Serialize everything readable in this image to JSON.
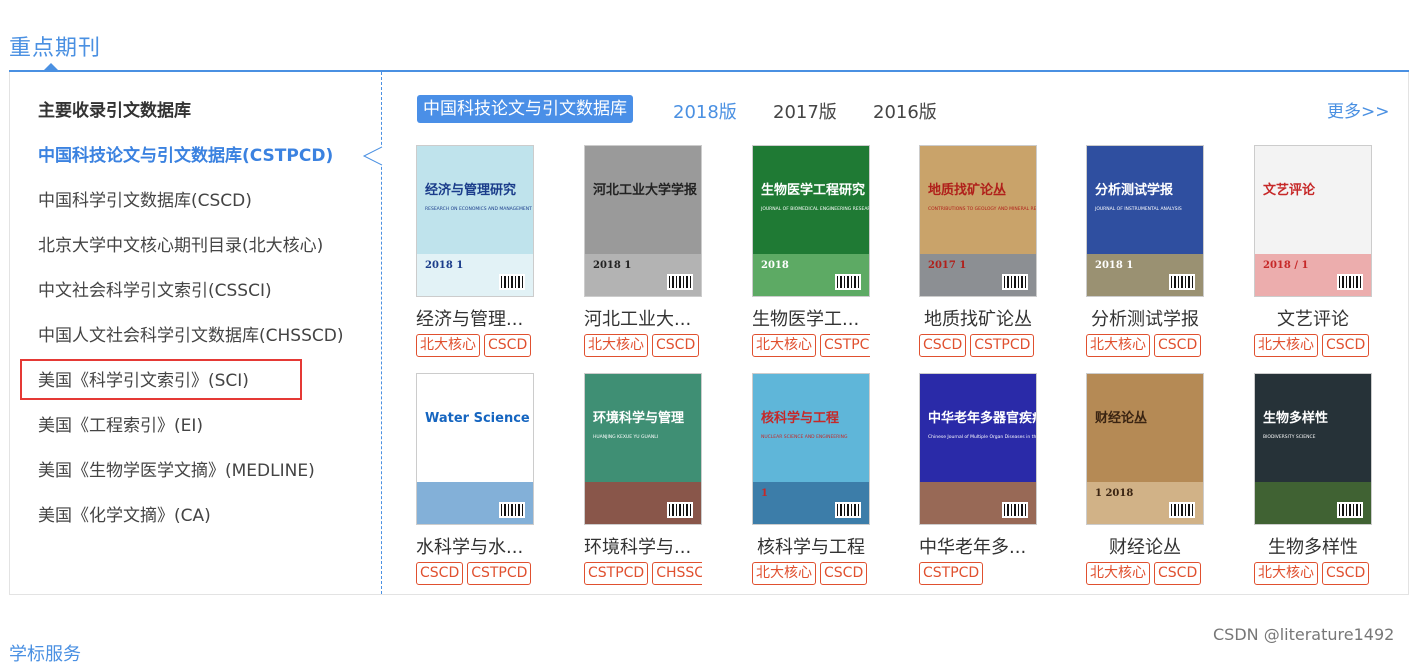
{
  "section": {
    "title": "重点期刊"
  },
  "sidebar": {
    "heading": "主要收录引文数据库",
    "items": [
      {
        "label": "中国科技论文与引文数据库(CSTPCD)"
      },
      {
        "label": "中国科学引文数据库(CSCD)"
      },
      {
        "label": "北京大学中文核心期刊目录(北大核心)"
      },
      {
        "label": "中文社会科学引文索引(CSSCI)"
      },
      {
        "label": "中国人文社会科学引文数据库(CHSSCD)"
      },
      {
        "label": "美国《科学引文索引》(SCI)"
      },
      {
        "label": "美国《工程索引》(EI)"
      },
      {
        "label": "美国《生物学医学文摘》(MEDLINE)"
      },
      {
        "label": "美国《化学文摘》(CA)"
      }
    ]
  },
  "tabs": {
    "active": "中国科技论文与引文数据库",
    "versions": [
      "2018版",
      "2017版",
      "2016版"
    ],
    "more": "更多>>"
  },
  "journals": [
    {
      "name": "经济与管理...",
      "tags": [
        "北大核心",
        "CSCD"
      ],
      "cover_title": "经济与管理研究",
      "cover_sub": "RESEARCH ON ECONOMICS AND MANAGEMENT",
      "cover_year": "2018 1"
    },
    {
      "name": "河北工业大...",
      "tags": [
        "北大核心",
        "CSCD"
      ],
      "cover_title": "河北工业大学学报",
      "cover_sub": "",
      "cover_year": "2018 1"
    },
    {
      "name": "生物医学工...",
      "tags": [
        "北大核心",
        "CSTPCD"
      ],
      "cover_title": "生物医学工程研究",
      "cover_sub": "JOURNAL OF BIOMEDICAL ENGINEERING RESEARCH",
      "cover_year": "2018"
    },
    {
      "name": "地质找矿论丛",
      "tags": [
        "CSCD",
        "CSTPCD"
      ],
      "cover_title": "地质找矿论丛",
      "cover_sub": "CONTRIBUTIONS TO GEOLOGY AND MINERAL RESOURCES RESEARCH",
      "cover_year": "2017 1"
    },
    {
      "name": "分析测试学报",
      "tags": [
        "北大核心",
        "CSCD"
      ],
      "cover_title": "分析测试学报",
      "cover_sub": "JOURNAL OF INSTRUMENTAL ANALYSIS",
      "cover_year": "2018 1"
    },
    {
      "name": "文艺评论",
      "tags": [
        "北大核心",
        "CSCD"
      ],
      "cover_title": "文艺评论",
      "cover_sub": "",
      "cover_year": "2018 / 1"
    },
    {
      "name": "水科学与水...",
      "tags": [
        "CSCD",
        "CSTPCD"
      ],
      "cover_title": "Water Science and Engineering",
      "cover_sub": "",
      "cover_year": ""
    },
    {
      "name": "环境科学与...",
      "tags": [
        "CSTPCD",
        "CHSSCD"
      ],
      "cover_title": "环境科学与管理",
      "cover_sub": "HUANJING KEXUE YU GUANLI",
      "cover_year": ""
    },
    {
      "name": "核科学与工程",
      "tags": [
        "北大核心",
        "CSCD"
      ],
      "cover_title": "核科学与工程",
      "cover_sub": "NUCLEAR SCIENCE AND ENGINEERING",
      "cover_year": "1"
    },
    {
      "name": "中华老年多...",
      "tags": [
        "CSTPCD"
      ],
      "cover_title": "中华老年多器官疾病杂志",
      "cover_sub": "Chinese Journal of Multiple Organ Diseases in the Elderly",
      "cover_year": ""
    },
    {
      "name": "财经论丛",
      "tags": [
        "北大核心",
        "CSCD"
      ],
      "cover_title": "财经论丛",
      "cover_sub": "",
      "cover_year": "1 2018"
    },
    {
      "name": "生物多样性",
      "tags": [
        "北大核心",
        "CSCD"
      ],
      "cover_title": "生物多样性",
      "cover_sub": "BIODIVERSITY SCIENCE",
      "cover_year": ""
    }
  ],
  "footer": {
    "next_section": "学标服务"
  },
  "watermark": "CSDN @literature1492",
  "colors": {
    "accent": "#4a90e2",
    "tag": "#e0502f",
    "highlight": "#e53935"
  }
}
